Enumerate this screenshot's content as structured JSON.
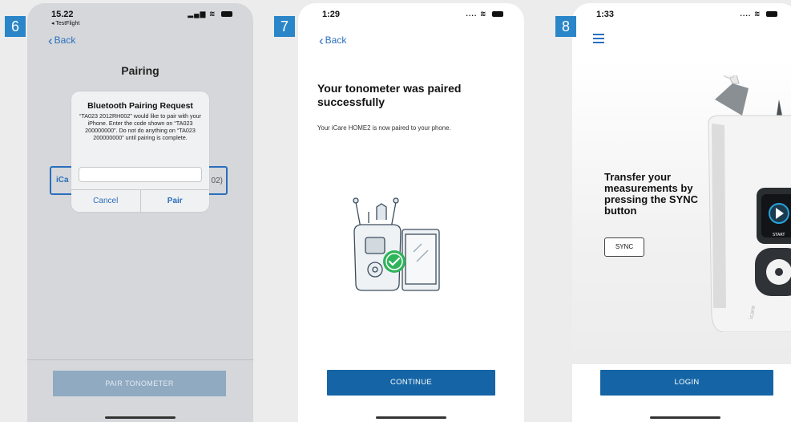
{
  "steps": [
    "6",
    "7",
    "8"
  ],
  "screen6": {
    "status_time": "15.22",
    "status_sub": "◂ TestFlight",
    "back_label": "Back",
    "title": "Pairing",
    "field_left": "iCa",
    "field_right": "02)",
    "dialog": {
      "title": "Bluetooth Pairing Request",
      "body": "“TA023 2012RH002” would like to pair with your iPhone. Enter the code shown on “TA023 200000000”. Do not do anything on “TA023 200000000” until pairing is complete.",
      "input_value": "",
      "cancel": "Cancel",
      "pair": "Pair"
    },
    "button_label": "PAIR TONOMETER"
  },
  "screen7": {
    "status_time": "1:29",
    "back_label": "Back",
    "title": "Your tonometer was paired successfully",
    "subtitle": "Your iCare HOME2 is now paired to your phone.",
    "button_label": "CONTINUE"
  },
  "screen8": {
    "status_time": "1:33",
    "title": "Transfer your measurements by pressing the SYNC button",
    "sync_label": "SYNC",
    "device_start": "START",
    "device_brand": "icare",
    "button_label": "LOGIN"
  },
  "colors": {
    "accent": "#2a86c8",
    "primary_button": "#1565a6",
    "disabled_button": "#8faac1",
    "link": "#2a6ebd",
    "success": "#2fb45a"
  }
}
